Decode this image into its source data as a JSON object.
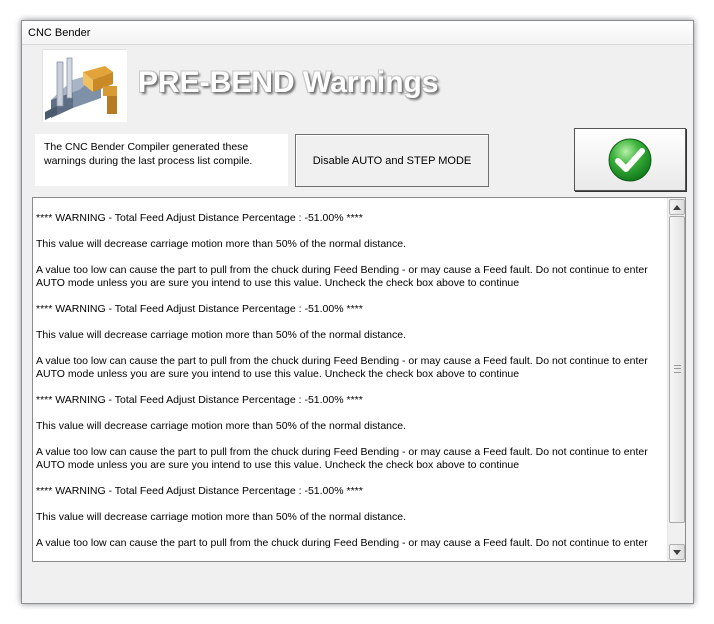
{
  "window": {
    "title": "CNC Bender"
  },
  "header": {
    "title": "PRE-BEND Warnings",
    "logo_icon": "cnc-bender-machine-icon"
  },
  "info": {
    "text": "The CNC Bender Compiler generated these warnings during the last process list compile."
  },
  "buttons": {
    "disable_label": "Disable AUTO and STEP MODE",
    "ok_icon": "green-checkmark-icon"
  },
  "warnings": [
    {
      "title": "**** WARNING - Total Feed Adjust Distance Percentage : -51.00% ****",
      "line1": "This value will decrease carriage motion more than 50% of the normal distance.",
      "line2": "A value too low can cause the part to pull from the chuck during Feed Bending - or may cause a Feed fault.  Do not continue to enter AUTO mode unless you are sure you intend to use this value.  Uncheck the check box above to continue"
    },
    {
      "title": "**** WARNING - Total Feed Adjust Distance Percentage : -51.00% ****",
      "line1": "This value will decrease carriage motion more than 50% of the normal distance.",
      "line2": "A value too low can cause the part to pull from the chuck during Feed Bending - or may cause a Feed fault.  Do not continue to enter AUTO mode unless you are sure you intend to use this value.  Uncheck the check box above to continue"
    },
    {
      "title": "**** WARNING - Total Feed Adjust Distance Percentage : -51.00% ****",
      "line1": "This value will decrease carriage motion more than 50% of the normal distance.",
      "line2": "A value too low can cause the part to pull from the chuck during Feed Bending - or may cause a Feed fault.  Do not continue to enter AUTO mode unless you are sure you intend to use this value.  Uncheck the check box above to continue"
    },
    {
      "title": "**** WARNING - Total Feed Adjust Distance Percentage : -51.00% ****",
      "line1": "This value will decrease carriage motion more than 50% of the normal distance.",
      "line2": "A value too low can cause the part to pull from the chuck during Feed Bending - or may cause a Feed fault.  Do not continue to enter"
    }
  ],
  "colors": {
    "check_green": "#3cb43c",
    "window_bg": "#f0f0f0"
  }
}
